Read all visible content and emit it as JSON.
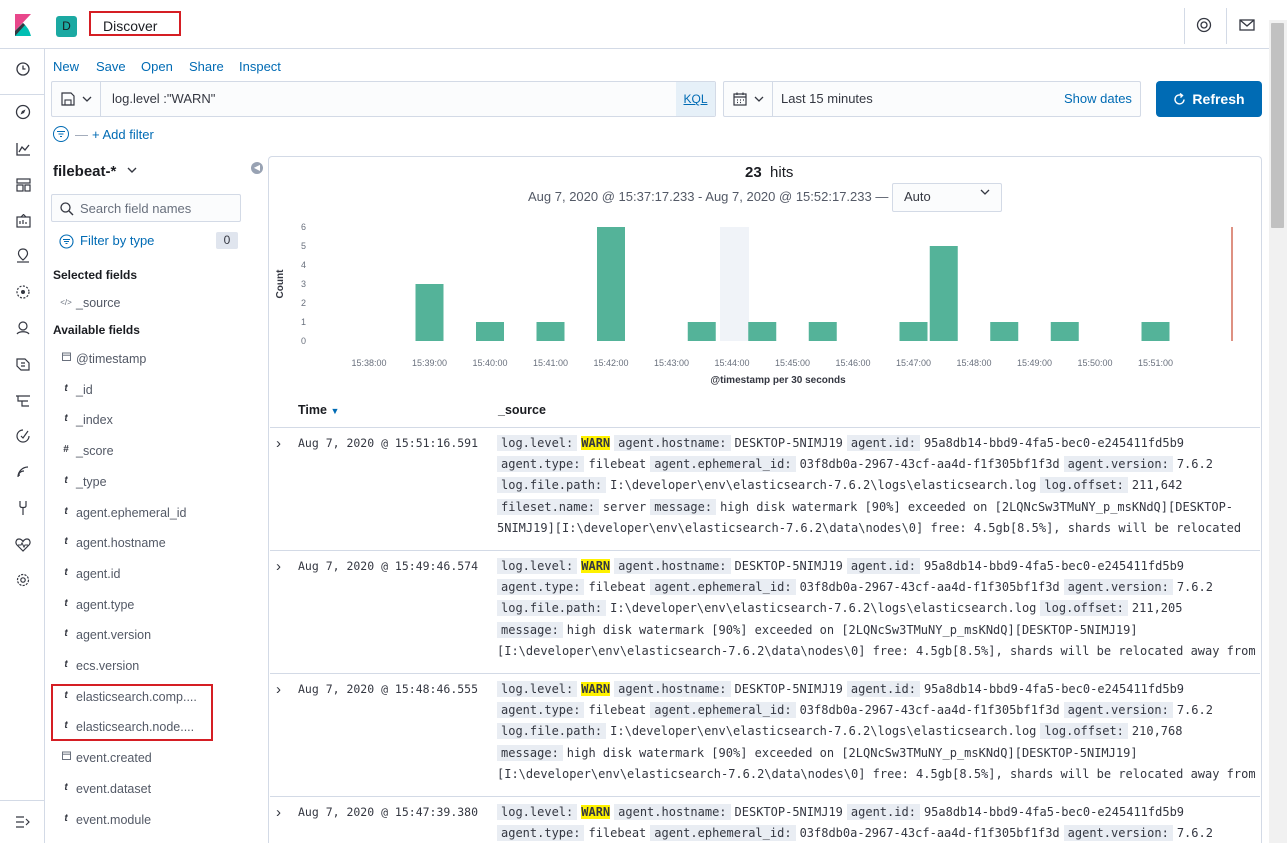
{
  "app": {
    "space_initial": "D",
    "breadcrumb": "Discover"
  },
  "menu": [
    "New",
    "Save",
    "Open",
    "Share",
    "Inspect"
  ],
  "query": {
    "value": "log.level :\"WARN\"",
    "language": "KQL"
  },
  "time": {
    "label": "Last 15 minutes",
    "show_dates": "Show dates",
    "refresh": "Refresh"
  },
  "filters": {
    "add_filter": "+ Add filter",
    "dash": "—"
  },
  "sidebar": {
    "index_pattern": "filebeat-*",
    "search_placeholder": "Search field names",
    "filter_by_type": "Filter by type",
    "filter_count": "0",
    "selected_title": "Selected fields",
    "selected_fields": [
      {
        "type": "</>",
        "name": "_source"
      }
    ],
    "available_title": "Available fields",
    "available_fields": [
      {
        "type": "cal",
        "name": "@timestamp"
      },
      {
        "type": "t",
        "name": "_id"
      },
      {
        "type": "t",
        "name": "_index"
      },
      {
        "type": "#",
        "name": "_score"
      },
      {
        "type": "t",
        "name": "_type"
      },
      {
        "type": "t",
        "name": "agent.ephemeral_id"
      },
      {
        "type": "t",
        "name": "agent.hostname"
      },
      {
        "type": "t",
        "name": "agent.id"
      },
      {
        "type": "t",
        "name": "agent.type"
      },
      {
        "type": "t",
        "name": "agent.version"
      },
      {
        "type": "t",
        "name": "ecs.version"
      },
      {
        "type": "t",
        "name": "elasticsearch.comp...."
      },
      {
        "type": "t",
        "name": "elasticsearch.node...."
      },
      {
        "type": "cal",
        "name": "event.created"
      },
      {
        "type": "t",
        "name": "event.dataset"
      },
      {
        "type": "t",
        "name": "event.module"
      }
    ]
  },
  "histogram": {
    "hits": "23",
    "hits_label": "hits",
    "range": "Aug 7, 2020 @ 15:37:17.233 - Aug 7, 2020 @ 15:52:17.233 —",
    "interval": "Auto"
  },
  "chart_data": {
    "type": "bar",
    "xlabel": "@timestamp per 30 seconds",
    "ylabel": "Count",
    "ylim": [
      0,
      6
    ],
    "y_ticks": [
      "0",
      "1",
      "2",
      "3",
      "4",
      "5",
      "6"
    ],
    "x_ticks": [
      "15:38:00",
      "15:39:00",
      "15:40:00",
      "15:41:00",
      "15:42:00",
      "15:43:00",
      "15:44:00",
      "15:45:00",
      "15:46:00",
      "15:47:00",
      "15:48:00",
      "15:49:00",
      "15:50:00",
      "15:51:00"
    ],
    "bars": [
      {
        "x": "15:39:00",
        "value": 3
      },
      {
        "x": "15:40:00",
        "value": 1
      },
      {
        "x": "15:41:00",
        "value": 1
      },
      {
        "x": "15:42:00",
        "value": 6
      },
      {
        "x": "15:43:30",
        "value": 1
      },
      {
        "x": "15:44:30",
        "value": 1
      },
      {
        "x": "15:45:30",
        "value": 1
      },
      {
        "x": "15:47:00",
        "value": 1
      },
      {
        "x": "15:47:30",
        "value": 5
      },
      {
        "x": "15:48:30",
        "value": 1
      },
      {
        "x": "15:49:30",
        "value": 1
      },
      {
        "x": "15:51:00",
        "value": 1
      }
    ],
    "color": "#54b399",
    "now_line_color": "#d36c59"
  },
  "table": {
    "col_time": "Time",
    "col_source": "_source",
    "rows": [
      {
        "time": "Aug 7, 2020 @ 15:51:16.591",
        "lines": [
          [
            [
              "log.level:",
              "WARN",
              true
            ],
            [
              "agent.hostname:",
              "DESKTOP-5NIMJ19"
            ],
            [
              "agent.id:",
              "95a8db14-bbd9-4fa5-bec0-e245411fd5b9"
            ]
          ],
          [
            [
              "agent.type:",
              "filebeat"
            ],
            [
              "agent.ephemeral_id:",
              "03f8db0a-2967-43cf-aa4d-f1f305bf1f3d"
            ],
            [
              "agent.version:",
              "7.6.2"
            ]
          ],
          [
            [
              "log.file.path:",
              "I:\\developer\\env\\elasticsearch-7.6.2\\logs\\elasticsearch.log"
            ],
            [
              "log.offset:",
              "211,642"
            ]
          ],
          [
            [
              "fileset.name:",
              "server"
            ],
            [
              "message:",
              "high disk watermark [90%] exceeded on [2LQNcSw3TMuNY_p_msKNdQ][DESKTOP-"
            ]
          ],
          [
            [
              "",
              "5NIMJ19][I:\\developer\\env\\elasticsearch-7.6.2\\data\\nodes\\0] free: 4.5gb[8.5%], shards will be relocated"
            ]
          ]
        ]
      },
      {
        "time": "Aug 7, 2020 @ 15:49:46.574",
        "lines": [
          [
            [
              "log.level:",
              "WARN",
              true
            ],
            [
              "agent.hostname:",
              "DESKTOP-5NIMJ19"
            ],
            [
              "agent.id:",
              "95a8db14-bbd9-4fa5-bec0-e245411fd5b9"
            ]
          ],
          [
            [
              "agent.type:",
              "filebeat"
            ],
            [
              "agent.ephemeral_id:",
              "03f8db0a-2967-43cf-aa4d-f1f305bf1f3d"
            ],
            [
              "agent.version:",
              "7.6.2"
            ]
          ],
          [
            [
              "log.file.path:",
              "I:\\developer\\env\\elasticsearch-7.6.2\\logs\\elasticsearch.log"
            ],
            [
              "log.offset:",
              "211,205"
            ]
          ],
          [
            [
              "message:",
              "high disk watermark [90%] exceeded on [2LQNcSw3TMuNY_p_msKNdQ][DESKTOP-5NIMJ19]"
            ]
          ],
          [
            [
              "",
              "[I:\\developer\\env\\elasticsearch-7.6.2\\data\\nodes\\0] free: 4.5gb[8.5%], shards will be relocated away from"
            ]
          ]
        ]
      },
      {
        "time": "Aug 7, 2020 @ 15:48:46.555",
        "lines": [
          [
            [
              "log.level:",
              "WARN",
              true
            ],
            [
              "agent.hostname:",
              "DESKTOP-5NIMJ19"
            ],
            [
              "agent.id:",
              "95a8db14-bbd9-4fa5-bec0-e245411fd5b9"
            ]
          ],
          [
            [
              "agent.type:",
              "filebeat"
            ],
            [
              "agent.ephemeral_id:",
              "03f8db0a-2967-43cf-aa4d-f1f305bf1f3d"
            ],
            [
              "agent.version:",
              "7.6.2"
            ]
          ],
          [
            [
              "log.file.path:",
              "I:\\developer\\env\\elasticsearch-7.6.2\\logs\\elasticsearch.log"
            ],
            [
              "log.offset:",
              "210,768"
            ]
          ],
          [
            [
              "message:",
              "high disk watermark [90%] exceeded on [2LQNcSw3TMuNY_p_msKNdQ][DESKTOP-5NIMJ19]"
            ]
          ],
          [
            [
              "",
              "[I:\\developer\\env\\elasticsearch-7.6.2\\data\\nodes\\0] free: 4.5gb[8.5%], shards will be relocated away from"
            ]
          ]
        ]
      },
      {
        "time": "Aug 7, 2020 @ 15:47:39.380",
        "lines": [
          [
            [
              "log.level:",
              "WARN",
              true
            ],
            [
              "agent.hostname:",
              "DESKTOP-5NIMJ19"
            ],
            [
              "agent.id:",
              "95a8db14-bbd9-4fa5-bec0-e245411fd5b9"
            ]
          ],
          [
            [
              "agent.type:",
              "filebeat"
            ],
            [
              "agent.ephemeral_id:",
              "03f8db0a-2967-43cf-aa4d-f1f305bf1f3d"
            ],
            [
              "agent.version:",
              "7.6.2"
            ]
          ]
        ]
      }
    ]
  }
}
